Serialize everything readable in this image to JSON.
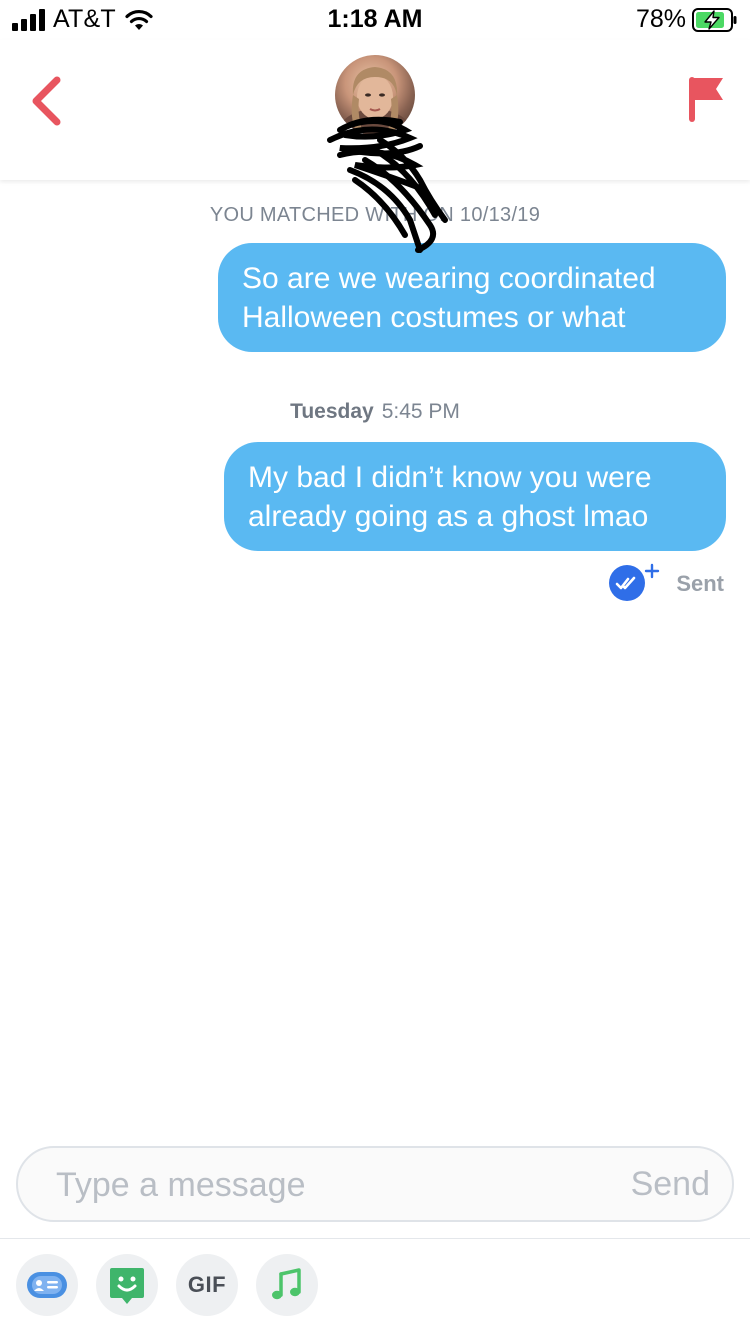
{
  "status_bar": {
    "carrier": "AT&T",
    "time": "1:18 AM",
    "battery": "78%"
  },
  "header": {
    "accent_color": "#e8555f"
  },
  "chat": {
    "matched_text": "YOU MATCHED WITH ON 10/13/19",
    "messages": [
      {
        "text": "So are we wearing coordinated Halloween costumes or what"
      },
      {
        "text": "My bad I didn’t know you were already going as a ghost lmao"
      }
    ],
    "timestamp": {
      "day": "Tuesday",
      "time": "5:45 PM"
    },
    "status": "Sent",
    "bubble_color": "#5ab9f2"
  },
  "composer": {
    "placeholder": "Type a message",
    "send_label": "Send"
  },
  "toolbar": {
    "gif_label": "GIF",
    "icons": [
      "contact-card-icon",
      "sticker-icon",
      "gif-icon",
      "music-icon"
    ]
  }
}
